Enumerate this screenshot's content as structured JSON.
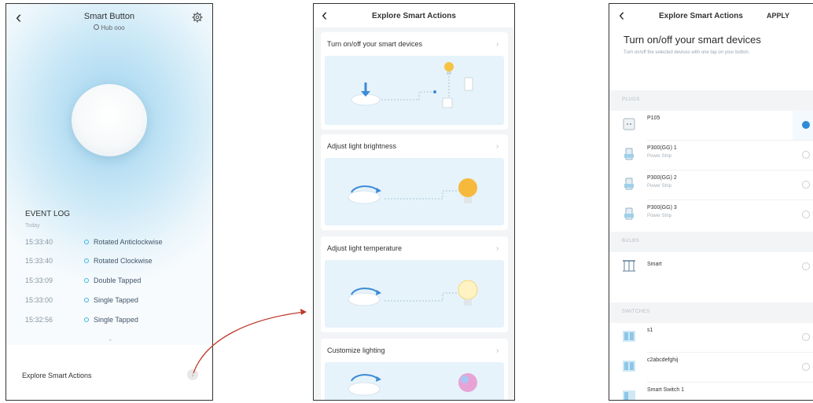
{
  "screen1": {
    "title": "Smart Button",
    "hub": "Hub ooo",
    "event_log_heading": "EVENT LOG",
    "today": "Today",
    "events": [
      {
        "time": "15:33:40",
        "text": "Rotated Anticlockwise"
      },
      {
        "time": "15:33:40",
        "text": "Rotated Clockwise"
      },
      {
        "time": "15:33:09",
        "text": "Double Tapped"
      },
      {
        "time": "15:33:00",
        "text": "Single Tapped"
      },
      {
        "time": "15:32:56",
        "text": "Single Tapped"
      }
    ],
    "explore_label": "Explore Smart Actions"
  },
  "screen2": {
    "title": "Explore Smart Actions",
    "cards": [
      {
        "title": "Turn on/off your smart devices"
      },
      {
        "title": "Adjust light brightness"
      },
      {
        "title": "Adjust light temperature"
      },
      {
        "title": "Customize lighting"
      }
    ]
  },
  "screen3": {
    "title": "Explore Smart Actions",
    "apply": "APPLY",
    "heading": "Turn on/off your smart devices",
    "description": "Turn on/off the selected devices with one tap on your button.",
    "sections": {
      "plugs": "PLUGS",
      "bulbs": "BULBS",
      "switches": "SWITCHES"
    },
    "devices": [
      {
        "name": "P105",
        "sub": "",
        "selected": true
      },
      {
        "name": "P300(GG) 1",
        "sub": "Power Strip",
        "selected": false
      },
      {
        "name": "P300(GG) 2",
        "sub": "Power Strip",
        "selected": false
      },
      {
        "name": "P300(GG) 3",
        "sub": "Power Strip",
        "selected": false
      },
      {
        "name": "Smart",
        "sub": "",
        "selected": false
      },
      {
        "name": "s1",
        "sub": "",
        "selected": false
      },
      {
        "name": "c2abcdefghij",
        "sub": "",
        "selected": false
      },
      {
        "name": "Smart Switch 1",
        "sub": "",
        "selected": false
      }
    ]
  },
  "colors": {
    "accent": "#2f8bd8",
    "arrow": "#c0392b",
    "event_dot": "#41b6e6"
  }
}
